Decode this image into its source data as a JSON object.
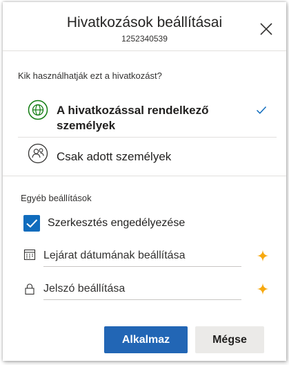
{
  "header": {
    "title": "Hivatkozások beállításai",
    "subtitle": "1252340539",
    "close_icon": "close-icon"
  },
  "audience": {
    "label": "Kik használhatják ezt a hivatkozást?",
    "options": [
      {
        "label": "A hivatkozással rendelkező személyek",
        "icon": "globe-icon",
        "selected": true
      },
      {
        "label": "Csak adott személyek",
        "icon": "people-icon",
        "selected": false
      }
    ]
  },
  "other": {
    "label": "Egyéb beállítások",
    "allow_edit": {
      "label": "Szerkesztés engedélyezése",
      "checked": true
    },
    "expiry": {
      "placeholder": "Lejárat dátumának beállítása",
      "icon": "calendar-icon",
      "premium_icon": "premium-sparkle-icon"
    },
    "password": {
      "placeholder": "Jelszó beállítása",
      "icon": "lock-icon",
      "premium_icon": "premium-sparkle-icon"
    }
  },
  "footer": {
    "apply_label": "Alkalmaz",
    "cancel_label": "Mégse"
  },
  "colors": {
    "accent": "#0f6cbd",
    "primary_button": "#2266b5",
    "globe_green": "#107c10",
    "premium_star": "#f7a90f"
  }
}
